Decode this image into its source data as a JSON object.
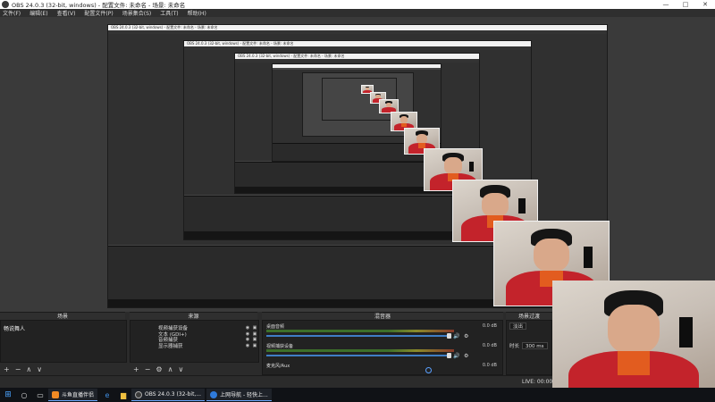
{
  "window": {
    "title": "OBS 24.0.3 (32-bit, windows) - 配置文件: 未命名 - 场景: 未命名",
    "controls": [
      "—",
      "□",
      "✕"
    ]
  },
  "menu": [
    "文件(F)",
    "编辑(E)",
    "查看(V)",
    "配置文件(P)",
    "场景集合(S)",
    "工具(T)",
    "帮助(H)"
  ],
  "nested": {
    "title": "OBS 24.0.3 (32-bit, windows) - 配置文件: 未命名 - 场景: 未命名",
    "docks": [
      "场景",
      "来源",
      "混音器"
    ]
  },
  "docks": {
    "scenes": {
      "header": "场景",
      "items": [
        "畅说舞人"
      ]
    },
    "sources": {
      "header": "来源",
      "items": [
        "视频捕获设备",
        "文本 (GDI+)",
        "音频捕获",
        "显示器捕获"
      ]
    },
    "mixer": {
      "header": "混音器",
      "channels": [
        {
          "name": "桌面音频",
          "db": "0.0 dB"
        },
        {
          "name": "视频捕获设备",
          "db": "0.0 dB"
        },
        {
          "name": "麦克风/Aux",
          "db": "0.0 dB"
        }
      ]
    },
    "transitions": {
      "header": "场景过渡",
      "type": "淡出",
      "duration_label": "时长",
      "duration": "300 ms"
    }
  },
  "dock_footer_symbols": [
    "+",
    "−",
    "∧",
    "∨"
  ],
  "status": {
    "live": "LIVE: 00:00:00"
  },
  "taskbar": {
    "apps": [
      {
        "label": "斗鱼直播伴侣",
        "color": "#f08a24"
      },
      {
        "label": "OBS 24.0.3 (32-bit,...",
        "color": "#3a3a3a"
      },
      {
        "label": "上网导航 - 轻快上...",
        "color": "#2f7bdc"
      }
    ]
  },
  "colors": {
    "mixer_slider": "#3f7ec6",
    "jacket_red": "#c3232b"
  }
}
